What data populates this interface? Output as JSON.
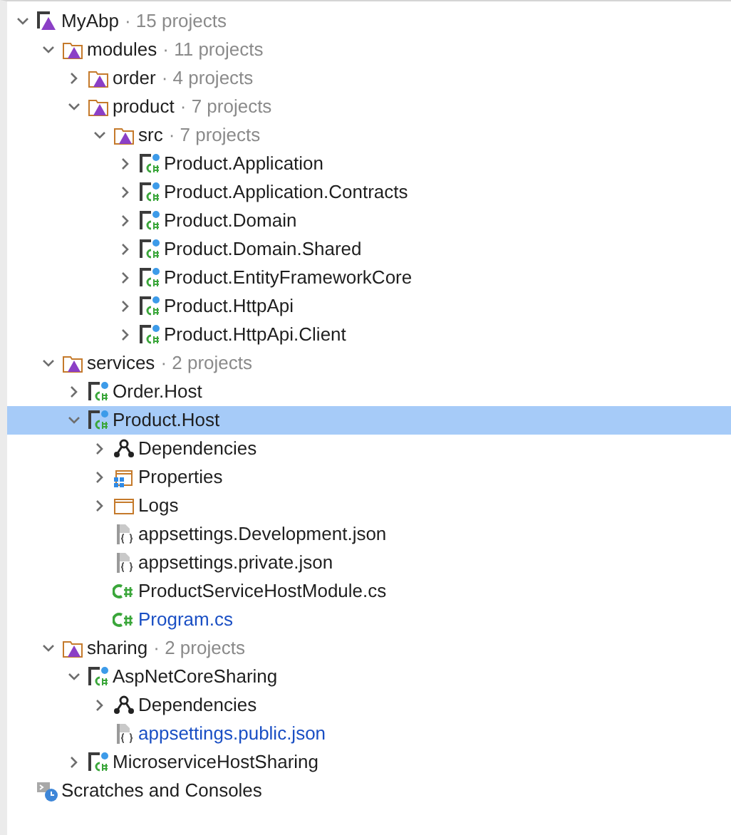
{
  "tree": [
    {
      "kind": "solution",
      "label": "MyAbp",
      "count": "· 15 projects",
      "expanded": true,
      "selected": false,
      "children": [
        {
          "kind": "solution-folder",
          "label": "modules",
          "count": "· 11 projects",
          "expanded": true,
          "selected": false,
          "children": [
            {
              "kind": "solution-folder",
              "label": "order",
              "count": "· 4 projects",
              "expanded": false,
              "selected": false
            },
            {
              "kind": "solution-folder",
              "label": "product",
              "count": "· 7 projects",
              "expanded": true,
              "selected": false,
              "children": [
                {
                  "kind": "solution-folder",
                  "label": "src",
                  "count": "· 7 projects",
                  "expanded": true,
                  "selected": false,
                  "children": [
                    {
                      "kind": "project",
                      "label": "Product.Application",
                      "expanded": false,
                      "selected": false
                    },
                    {
                      "kind": "project",
                      "label": "Product.Application.Contracts",
                      "expanded": false,
                      "selected": false
                    },
                    {
                      "kind": "project",
                      "label": "Product.Domain",
                      "expanded": false,
                      "selected": false
                    },
                    {
                      "kind": "project",
                      "label": "Product.Domain.Shared",
                      "expanded": false,
                      "selected": false
                    },
                    {
                      "kind": "project",
                      "label": "Product.EntityFrameworkCore",
                      "expanded": false,
                      "selected": false
                    },
                    {
                      "kind": "project",
                      "label": "Product.HttpApi",
                      "expanded": false,
                      "selected": false
                    },
                    {
                      "kind": "project",
                      "label": "Product.HttpApi.Client",
                      "expanded": false,
                      "selected": false
                    }
                  ]
                }
              ]
            }
          ]
        },
        {
          "kind": "solution-folder",
          "label": "services",
          "count": "· 2 projects",
          "expanded": true,
          "selected": false,
          "children": [
            {
              "kind": "project",
              "label": "Order.Host",
              "expanded": false,
              "selected": false
            },
            {
              "kind": "project",
              "label": "Product.Host",
              "expanded": true,
              "selected": true,
              "children": [
                {
                  "kind": "dependencies",
                  "label": "Dependencies",
                  "expanded": false,
                  "selected": false
                },
                {
                  "kind": "properties",
                  "label": "Properties",
                  "expanded": false,
                  "selected": false
                },
                {
                  "kind": "folder",
                  "label": "Logs",
                  "expanded": false,
                  "selected": false
                },
                {
                  "kind": "json",
                  "label": "appsettings.Development.json",
                  "modified": false,
                  "selected": false
                },
                {
                  "kind": "json",
                  "label": "appsettings.private.json",
                  "modified": false,
                  "selected": false
                },
                {
                  "kind": "cs",
                  "label": "ProductServiceHostModule.cs",
                  "modified": false,
                  "selected": false
                },
                {
                  "kind": "cs",
                  "label": "Program.cs",
                  "modified": true,
                  "selected": false
                }
              ]
            }
          ]
        },
        {
          "kind": "solution-folder",
          "label": "sharing",
          "count": "· 2 projects",
          "expanded": true,
          "selected": false,
          "children": [
            {
              "kind": "project",
              "label": "AspNetCoreSharing",
              "expanded": true,
              "selected": false,
              "children": [
                {
                  "kind": "dependencies",
                  "label": "Dependencies",
                  "expanded": false,
                  "selected": false
                },
                {
                  "kind": "json",
                  "label": "appsettings.public.json",
                  "modified": true,
                  "selected": false
                }
              ]
            },
            {
              "kind": "project",
              "label": "MicroserviceHostSharing",
              "expanded": false,
              "selected": false
            }
          ]
        }
      ]
    },
    {
      "kind": "scratches",
      "label": "Scratches and Consoles",
      "selected": false
    }
  ]
}
